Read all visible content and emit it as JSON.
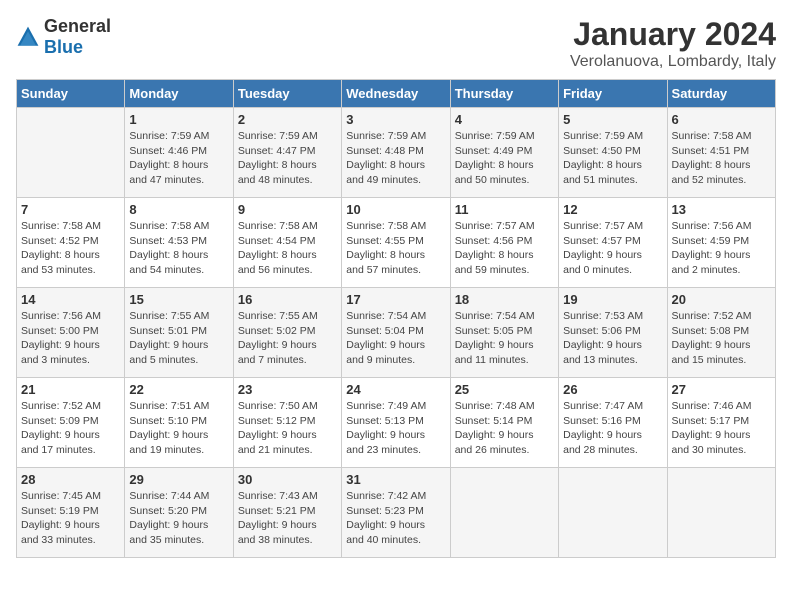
{
  "logo": {
    "general": "General",
    "blue": "Blue"
  },
  "header": {
    "title": "January 2024",
    "subtitle": "Verolanuova, Lombardy, Italy"
  },
  "weekdays": [
    "Sunday",
    "Monday",
    "Tuesday",
    "Wednesday",
    "Thursday",
    "Friday",
    "Saturday"
  ],
  "weeks": [
    [
      {
        "day": "",
        "info": ""
      },
      {
        "day": "1",
        "info": "Sunrise: 7:59 AM\nSunset: 4:46 PM\nDaylight: 8 hours\nand 47 minutes."
      },
      {
        "day": "2",
        "info": "Sunrise: 7:59 AM\nSunset: 4:47 PM\nDaylight: 8 hours\nand 48 minutes."
      },
      {
        "day": "3",
        "info": "Sunrise: 7:59 AM\nSunset: 4:48 PM\nDaylight: 8 hours\nand 49 minutes."
      },
      {
        "day": "4",
        "info": "Sunrise: 7:59 AM\nSunset: 4:49 PM\nDaylight: 8 hours\nand 50 minutes."
      },
      {
        "day": "5",
        "info": "Sunrise: 7:59 AM\nSunset: 4:50 PM\nDaylight: 8 hours\nand 51 minutes."
      },
      {
        "day": "6",
        "info": "Sunrise: 7:58 AM\nSunset: 4:51 PM\nDaylight: 8 hours\nand 52 minutes."
      }
    ],
    [
      {
        "day": "7",
        "info": "Sunrise: 7:58 AM\nSunset: 4:52 PM\nDaylight: 8 hours\nand 53 minutes."
      },
      {
        "day": "8",
        "info": "Sunrise: 7:58 AM\nSunset: 4:53 PM\nDaylight: 8 hours\nand 54 minutes."
      },
      {
        "day": "9",
        "info": "Sunrise: 7:58 AM\nSunset: 4:54 PM\nDaylight: 8 hours\nand 56 minutes."
      },
      {
        "day": "10",
        "info": "Sunrise: 7:58 AM\nSunset: 4:55 PM\nDaylight: 8 hours\nand 57 minutes."
      },
      {
        "day": "11",
        "info": "Sunrise: 7:57 AM\nSunset: 4:56 PM\nDaylight: 8 hours\nand 59 minutes."
      },
      {
        "day": "12",
        "info": "Sunrise: 7:57 AM\nSunset: 4:57 PM\nDaylight: 9 hours\nand 0 minutes."
      },
      {
        "day": "13",
        "info": "Sunrise: 7:56 AM\nSunset: 4:59 PM\nDaylight: 9 hours\nand 2 minutes."
      }
    ],
    [
      {
        "day": "14",
        "info": "Sunrise: 7:56 AM\nSunset: 5:00 PM\nDaylight: 9 hours\nand 3 minutes."
      },
      {
        "day": "15",
        "info": "Sunrise: 7:55 AM\nSunset: 5:01 PM\nDaylight: 9 hours\nand 5 minutes."
      },
      {
        "day": "16",
        "info": "Sunrise: 7:55 AM\nSunset: 5:02 PM\nDaylight: 9 hours\nand 7 minutes."
      },
      {
        "day": "17",
        "info": "Sunrise: 7:54 AM\nSunset: 5:04 PM\nDaylight: 9 hours\nand 9 minutes."
      },
      {
        "day": "18",
        "info": "Sunrise: 7:54 AM\nSunset: 5:05 PM\nDaylight: 9 hours\nand 11 minutes."
      },
      {
        "day": "19",
        "info": "Sunrise: 7:53 AM\nSunset: 5:06 PM\nDaylight: 9 hours\nand 13 minutes."
      },
      {
        "day": "20",
        "info": "Sunrise: 7:52 AM\nSunset: 5:08 PM\nDaylight: 9 hours\nand 15 minutes."
      }
    ],
    [
      {
        "day": "21",
        "info": "Sunrise: 7:52 AM\nSunset: 5:09 PM\nDaylight: 9 hours\nand 17 minutes."
      },
      {
        "day": "22",
        "info": "Sunrise: 7:51 AM\nSunset: 5:10 PM\nDaylight: 9 hours\nand 19 minutes."
      },
      {
        "day": "23",
        "info": "Sunrise: 7:50 AM\nSunset: 5:12 PM\nDaylight: 9 hours\nand 21 minutes."
      },
      {
        "day": "24",
        "info": "Sunrise: 7:49 AM\nSunset: 5:13 PM\nDaylight: 9 hours\nand 23 minutes."
      },
      {
        "day": "25",
        "info": "Sunrise: 7:48 AM\nSunset: 5:14 PM\nDaylight: 9 hours\nand 26 minutes."
      },
      {
        "day": "26",
        "info": "Sunrise: 7:47 AM\nSunset: 5:16 PM\nDaylight: 9 hours\nand 28 minutes."
      },
      {
        "day": "27",
        "info": "Sunrise: 7:46 AM\nSunset: 5:17 PM\nDaylight: 9 hours\nand 30 minutes."
      }
    ],
    [
      {
        "day": "28",
        "info": "Sunrise: 7:45 AM\nSunset: 5:19 PM\nDaylight: 9 hours\nand 33 minutes."
      },
      {
        "day": "29",
        "info": "Sunrise: 7:44 AM\nSunset: 5:20 PM\nDaylight: 9 hours\nand 35 minutes."
      },
      {
        "day": "30",
        "info": "Sunrise: 7:43 AM\nSunset: 5:21 PM\nDaylight: 9 hours\nand 38 minutes."
      },
      {
        "day": "31",
        "info": "Sunrise: 7:42 AM\nSunset: 5:23 PM\nDaylight: 9 hours\nand 40 minutes."
      },
      {
        "day": "",
        "info": ""
      },
      {
        "day": "",
        "info": ""
      },
      {
        "day": "",
        "info": ""
      }
    ]
  ]
}
